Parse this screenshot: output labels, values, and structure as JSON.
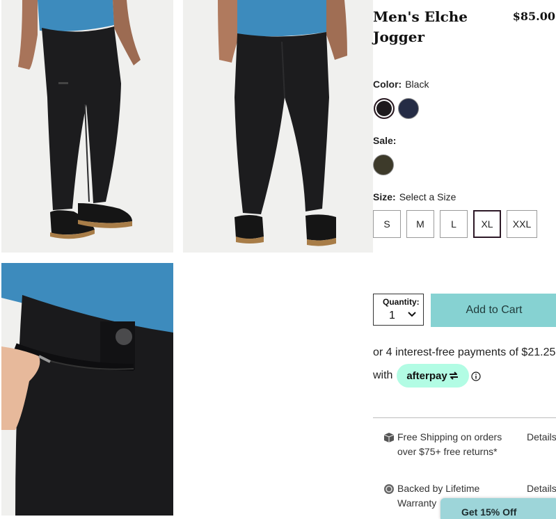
{
  "product": {
    "title": "Men's Elche Jogger",
    "price": "$85.00"
  },
  "color": {
    "label": "Color:",
    "value": "Black",
    "swatches": [
      {
        "name": "Black",
        "hex": "#1e1a1d",
        "selected": true
      },
      {
        "name": "Navy",
        "hex": "#252c45",
        "selected": false
      }
    ]
  },
  "sale": {
    "label": "Sale:",
    "swatches": [
      {
        "name": "Olive",
        "hex": "#3d3a2a"
      }
    ]
  },
  "size": {
    "label": "Size:",
    "value": "Select a Size",
    "options": [
      "S",
      "M",
      "L",
      "XL",
      "XXL"
    ],
    "selected": "XL"
  },
  "quantity": {
    "label": "Quantity:",
    "value": "1"
  },
  "cart": {
    "button_label": "Add to Cart",
    "button_color": "#86d2d2"
  },
  "afterpay": {
    "text": "or 4 interest-free payments of $21.25",
    "with": "with",
    "brand": "afterpay",
    "pill_color": "#b2fce4"
  },
  "perks": [
    {
      "icon": "box-icon",
      "text": "Free Shipping on orders over $75+ free returns*",
      "details": "Details"
    },
    {
      "icon": "badge-icon",
      "text": "Backed by Lifetime Warranty",
      "details": "Details"
    }
  ],
  "toast": {
    "text": "Get 15% Off"
  }
}
